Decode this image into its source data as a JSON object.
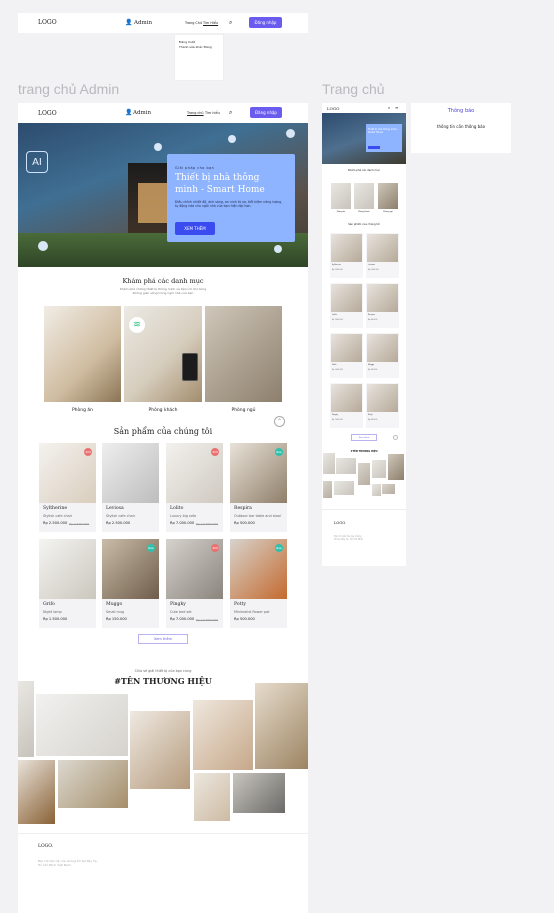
{
  "top_header": {
    "logo": "LOGO",
    "admin": "Admin",
    "lang_label": "Trang Chủ",
    "lang_link": "Tìm Hiểu",
    "register": "Đăng nhập",
    "dropdown": [
      "Đăng Xuất",
      "Thanh sửa khác Đăng"
    ]
  },
  "labels": {
    "admin_page": "trang chủ Admin",
    "user_page": "Trang chủ"
  },
  "admin_page": {
    "logo": "LOGO",
    "admin": "Admin",
    "nav_home": "Trang chủ",
    "nav_about": "Tìm hiểu",
    "register": "Đăng nhập",
    "hero": {
      "eyebrow": "Giải pháp cho bạn",
      "title": "Thiết bị nhà thông minh - Smart Home",
      "desc": "Điều chỉnh nhiệt độ, ánh sáng, an ninh từ xa, tiết kiệm năng lượng, tự động hóa cho ngôi nhà của bạn hiện đại hơn.",
      "cta": "XEM THÊM",
      "ai": "AI"
    },
    "categories": {
      "title": "Khám phá các danh mục",
      "subtitle": "Khám phá những thiết bị thông minh và tiện ích cho từng không gian sống trong ngôi nhà của bạn",
      "items": [
        "Phòng ăn",
        "Phòng khách",
        "Phòng ngủ"
      ]
    },
    "products": {
      "title": "Sản phẩm của chúng tôi",
      "items": [
        {
          "name": "Syltherine",
          "desc": "Stylish cafe chair",
          "price": "Rp 2.500.000",
          "old": "Rp 3.500.000",
          "badge": "-30%"
        },
        {
          "name": "Leviosa",
          "desc": "Stylish cafe chair",
          "price": "Rp 2.500.000",
          "old": "",
          "badge": ""
        },
        {
          "name": "Lolito",
          "desc": "Luxury big sofa",
          "price": "Rp 7.000.000",
          "old": "Rp 14.000.000",
          "badge": "-50%"
        },
        {
          "name": "Respira",
          "desc": "Outdoor bar table and stool",
          "price": "Rp 500.000",
          "old": "",
          "badge": "New"
        },
        {
          "name": "Grifo",
          "desc": "Night lamp",
          "price": "Rp 1.500.000",
          "old": "",
          "badge": ""
        },
        {
          "name": "Muggo",
          "desc": "Small mug",
          "price": "Rp 150.000",
          "old": "",
          "badge": "New"
        },
        {
          "name": "Pingky",
          "desc": "Cute bed set",
          "price": "Rp 7.000.000",
          "old": "Rp 14.000.000",
          "badge": "-50%"
        },
        {
          "name": "Potty",
          "desc": "Minimalist flower pot",
          "price": "Rp 500.000",
          "old": "",
          "badge": "New"
        }
      ],
      "more": "Xem thêm"
    },
    "brand": {
      "subtitle": "Chia sẻ giải thiết bị của bạn cùng",
      "title": "#TÊN THƯƠNG HIỆU"
    },
    "footer": {
      "logo": "LOGO.",
      "address": "Địa chỉ liên hệ của chúng tôi tại đây Tp. Hồ Chí Minh Việt Nam"
    }
  },
  "user_page": {
    "logo": "LOGO",
    "hero_title": "Thiết bị nhà thông minh - Smart Home",
    "categories_title": "Khám phá các danh mục",
    "categories": [
      "Phòng ăn",
      "Phòng khách",
      "Phòng ngủ"
    ],
    "products_title": "Sản phẩm của chúng tôi",
    "more": "Xem thêm",
    "brand": "#TÊN THƯƠNG HIỆU",
    "footer_logo": "LOGO.",
    "footer_text": "Địa chỉ liên hệ của chúng tôi tại đây Tp. Hồ Chí Minh"
  },
  "notification": {
    "title": "Thông báo",
    "body": "thông tin cần thông báo"
  },
  "colors": {
    "accent": "#6b5cf0",
    "hero_card": "#8fb4ff",
    "badge_red": "#e97171",
    "badge_green": "#2ec1ac"
  }
}
